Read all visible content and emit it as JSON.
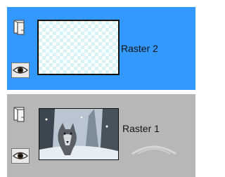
{
  "layers_panel": {
    "layers": [
      {
        "name": "Raster 2",
        "selected": true,
        "row_color": "#3399ff",
        "thumbnail": "transparent-checkerboard"
      },
      {
        "name": "Raster 1",
        "selected": false,
        "row_color": "#b7b7b7",
        "thumbnail": "wolf-in-snowy-forest-photo"
      }
    ],
    "icons": {
      "layer_properties": "layer-properties-icon",
      "visibility": "eye-icon"
    }
  }
}
